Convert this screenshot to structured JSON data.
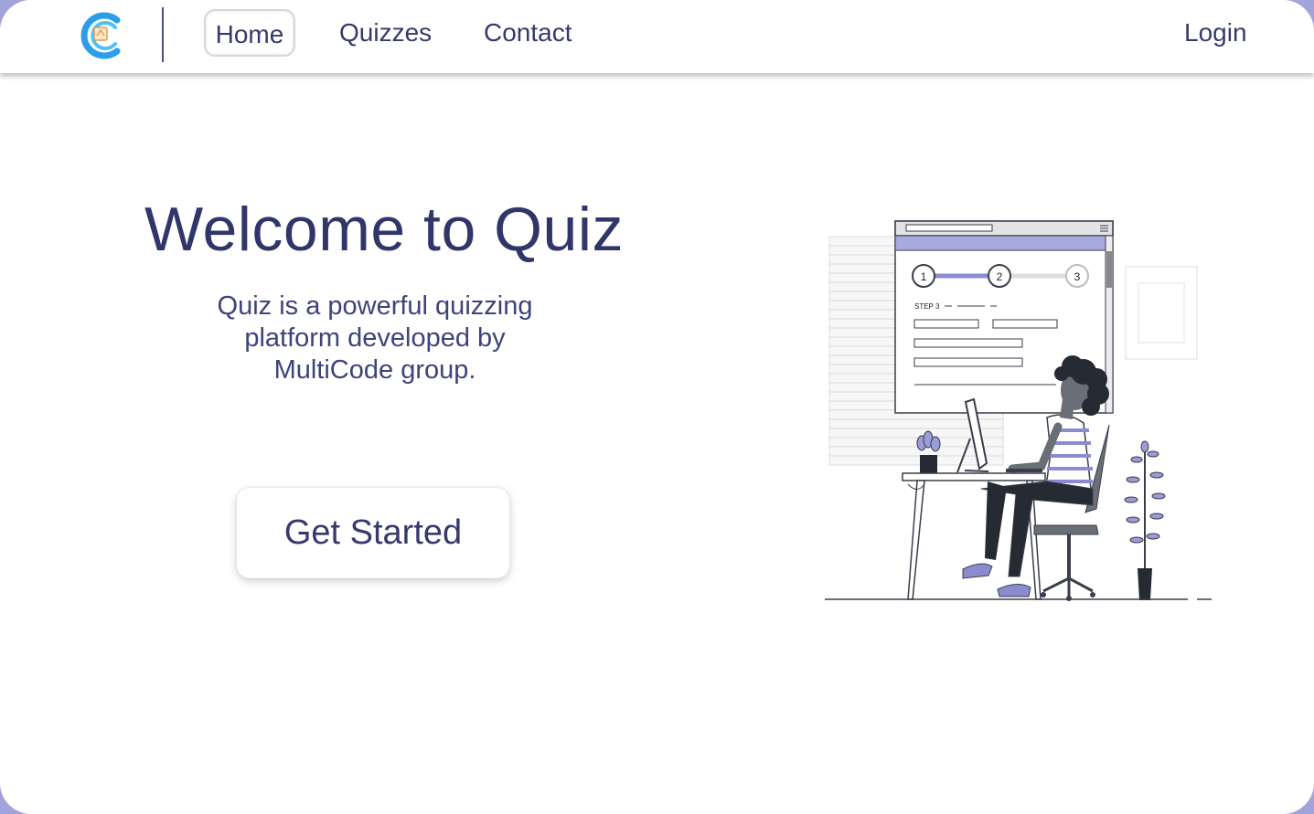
{
  "nav": {
    "logo_icon": "quiz-logo-icon",
    "links": [
      "Home",
      "Quizzes",
      "Contact"
    ],
    "active": "Home",
    "login": "Login"
  },
  "hero": {
    "title": "Welcome to Quiz",
    "subtitle": "Quiz is a powerful quizzing platform developed by MultiCode group.",
    "cta": "Get Started"
  },
  "illustration": {
    "icon": "woman-at-computer-illustration",
    "steps": [
      "1",
      "2",
      "3"
    ],
    "step_label": "STEP 3"
  },
  "colors": {
    "accent": "#a3a3dc",
    "text": "#353a6b",
    "background": "#ffffff"
  }
}
